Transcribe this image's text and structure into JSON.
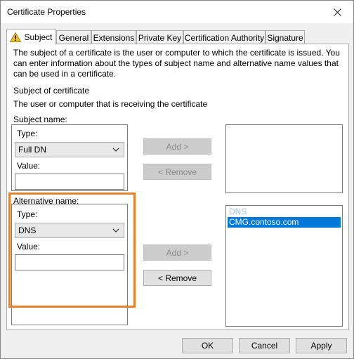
{
  "window": {
    "title": "Certificate Properties"
  },
  "tabs": [
    {
      "label": "Subject"
    },
    {
      "label": "General"
    },
    {
      "label": "Extensions"
    },
    {
      "label": "Private Key"
    },
    {
      "label": "Certification Authority"
    },
    {
      "label": "Signature"
    }
  ],
  "intro": "The subject of a certificate is the user or computer to which the certificate is issued. You can enter information about the types of subject name and alternative name values that can be used in a certificate.",
  "subject_of_certificate": {
    "heading": "Subject of certificate",
    "description": "The user or computer that is receiving the certificate"
  },
  "subject_name": {
    "group_label": "Subject name:",
    "type_label": "Type:",
    "type_value": "Full DN",
    "value_label": "Value:",
    "value": "",
    "add_label": "Add >",
    "remove_label": "< Remove"
  },
  "alternative_name": {
    "group_label": "Alternative name:",
    "type_label": "Type:",
    "type_value": "DNS",
    "value_label": "Value:",
    "value": "",
    "add_label": "Add >",
    "remove_label": "< Remove",
    "list": [
      {
        "text": "DNS",
        "style": "header"
      },
      {
        "text": "CMG.contoso.com",
        "style": "selected"
      }
    ]
  },
  "footer": {
    "ok_label": "OK",
    "cancel_label": "Cancel",
    "apply_label": "Apply"
  },
  "colors": {
    "highlight": "#e8822c",
    "selection": "#0078d7"
  }
}
